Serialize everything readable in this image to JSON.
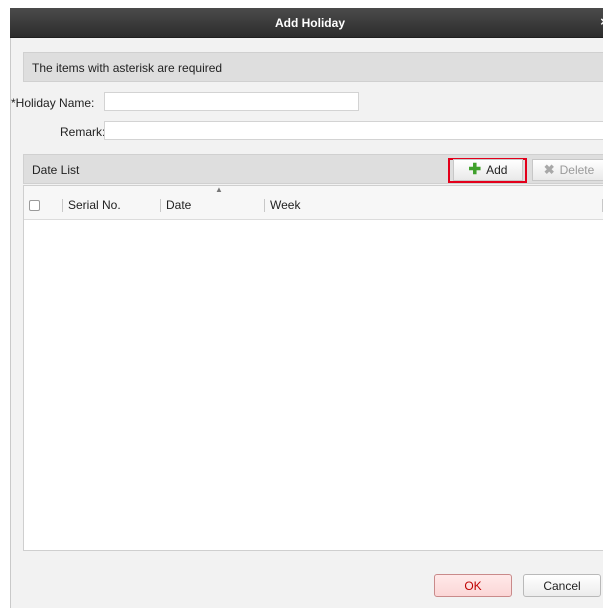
{
  "dialog": {
    "title": "Add Holiday",
    "close_glyph": "×"
  },
  "info": {
    "text": "The items with asterisk are required"
  },
  "form": {
    "holiday_name_label": "*Holiday Name:",
    "holiday_name_value": "",
    "remark_label": "Remark:",
    "remark_value": ""
  },
  "date_list": {
    "label": "Date List",
    "add_label": "Add",
    "add_icon": "plus-icon",
    "delete_label": "Delete",
    "delete_icon": "x-icon",
    "delete_enabled": false,
    "add_highlight_color": "#e3001b"
  },
  "table": {
    "columns": [
      "Serial No.",
      "Date",
      "Week"
    ],
    "sort_indicator": "▲",
    "rows": []
  },
  "footer": {
    "ok_label": "OK",
    "cancel_label": "Cancel",
    "ok_color": "#c00000"
  },
  "colors": {
    "titlebar": "#3a3a3a",
    "body_bg": "#f2f2f2",
    "bar_bg": "#dedede"
  }
}
